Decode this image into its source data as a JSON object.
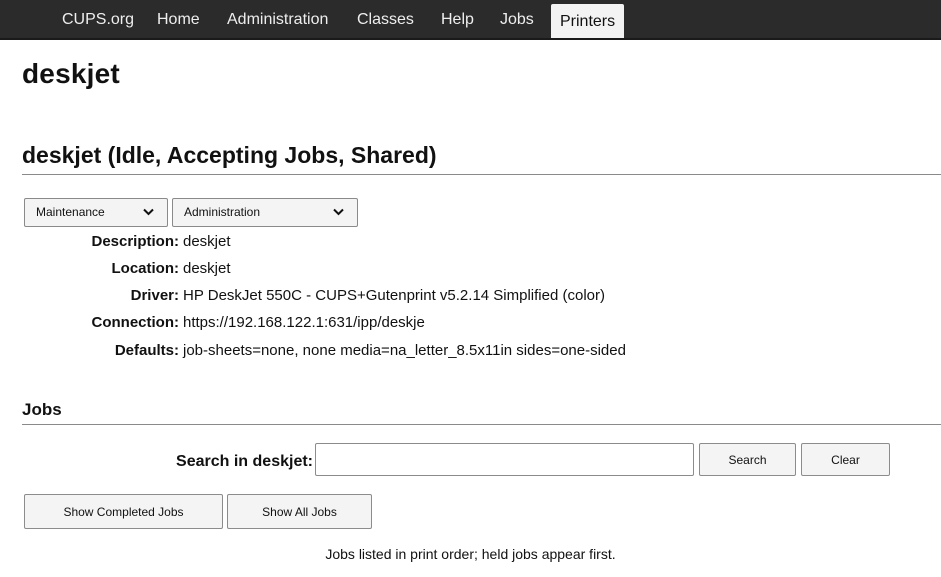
{
  "nav": {
    "items": [
      {
        "label": "CUPS.org"
      },
      {
        "label": "Home"
      },
      {
        "label": "Administration"
      },
      {
        "label": "Classes"
      },
      {
        "label": "Help"
      },
      {
        "label": "Jobs"
      },
      {
        "label": "Printers",
        "active": true
      }
    ]
  },
  "printer": {
    "name": "deskjet",
    "status_heading": "deskjet (Idle, Accepting Jobs, Shared)"
  },
  "dropdowns": {
    "maintenance": "Maintenance",
    "administration": "Administration"
  },
  "details": {
    "description_key": "Description:",
    "description": "deskjet",
    "location_key": "Location:",
    "location": "deskjet",
    "driver_key": "Driver:",
    "driver": "HP DeskJet 550C - CUPS+Gutenprint v5.2.14 Simplified (color)",
    "connection_key": "Connection:",
    "connection": "https://192.168.122.1:631/ipp/deskje",
    "defaults_key": "Defaults:",
    "defaults": "job-sheets=none, none media=na_letter_8.5x11in sides=one-sided"
  },
  "jobs": {
    "heading": "Jobs",
    "search_label": "Search in deskjet:",
    "search_value": "",
    "search_button": "Search",
    "clear_button": "Clear",
    "show_completed": "Show Completed Jobs",
    "show_all": "Show All Jobs",
    "note": "Jobs listed in print order; held jobs appear first."
  },
  "icons": {
    "dropdown": "chevron-down-icon"
  }
}
